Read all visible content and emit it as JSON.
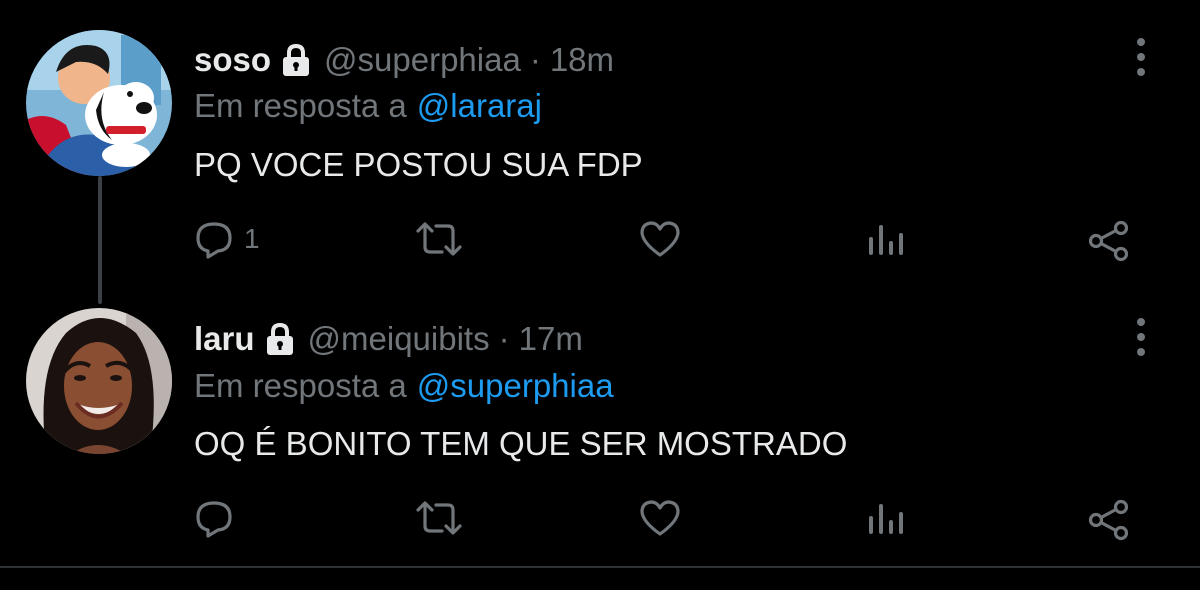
{
  "colors": {
    "background": "#000000",
    "text_primary": "#e7e9ea",
    "text_secondary": "#71767b",
    "accent": "#1d9bf0",
    "thread_line": "#3d4147"
  },
  "tweets": [
    {
      "display_name": "soso",
      "handle": "@superphiaa",
      "separator": "·",
      "time": "18m",
      "reply_prefix": "Em resposta a",
      "reply_mention": "@lararaj",
      "text": "PQ VOCE POSTOU SUA FDP",
      "reply_count": "1",
      "icons": [
        "lock-icon",
        "more-icon",
        "reply-icon",
        "retweet-icon",
        "like-icon",
        "views-icon",
        "share-icon"
      ]
    },
    {
      "display_name": "laru",
      "handle": "@meiquibits",
      "separator": "·",
      "time": "17m",
      "reply_prefix": "Em resposta a",
      "reply_mention": "@superphiaa",
      "text": "OQ É BONITO TEM QUE SER MOSTRADO",
      "reply_count": "",
      "icons": [
        "lock-icon",
        "more-icon",
        "reply-icon",
        "retweet-icon",
        "like-icon",
        "views-icon",
        "share-icon"
      ]
    }
  ]
}
